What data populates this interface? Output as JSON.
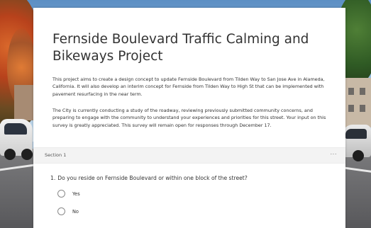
{
  "form": {
    "title": "Fernside Boulevard Traffic Calming and Bikeways Project",
    "description_1": "This project aims to create a design concept to update Fernside Boulevard from Tilden Way to San Jose Ave in Alameda, California. It will also develop an interim concept for Fernside from Tilden Way to High St that can be implemented with pavement resurfacing in the near term.",
    "description_2": "The City is currently conducting a study of the roadway, reviewing previously submitted community concerns, and preparing to engage with the community to understand your experiences and priorities for this street. Your input on this survey is greatly appreciated. This survey will remain open for responses through December 17."
  },
  "section": {
    "label": "Section 1",
    "more_icon": "ellipsis-icon",
    "more_glyph": "···"
  },
  "question": {
    "number": "1.",
    "text": "Do you reside on Fernside Boulevard or within one block of the street?",
    "options": [
      {
        "label": "Yes",
        "selected": false
      },
      {
        "label": "No",
        "selected": false
      }
    ]
  }
}
